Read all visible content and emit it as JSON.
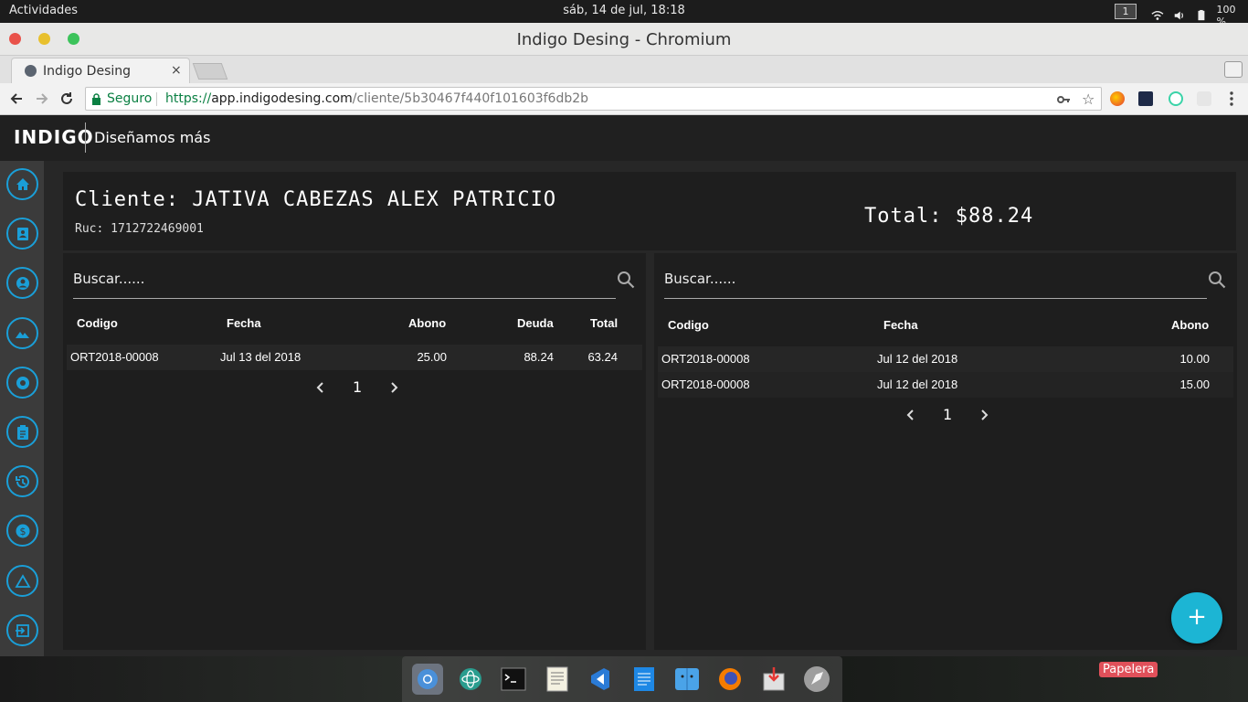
{
  "system_bar": {
    "activities": "Actividades",
    "clock": "sáb, 14 de jul, 18:18",
    "workspace": "1",
    "battery": "100 %"
  },
  "window": {
    "title": "Indigo Desing - Chromium"
  },
  "browser": {
    "tab_title": "Indigo Desing",
    "tab_close": "×",
    "secure_label": "Seguro",
    "url_scheme": "https://",
    "url_host": "app.indigodesing.com",
    "url_path": "/cliente/5b30467f440f101603f6db2b"
  },
  "app": {
    "logo": "INDIGO",
    "tagline": "Diseñamos más"
  },
  "client": {
    "name": "Cliente: JATIVA CABEZAS ALEX PATRICIO",
    "ruc": "Ruc: 1712722469001",
    "total": "Total: $88.24"
  },
  "left_panel": {
    "search_placeholder": "Buscar......",
    "columns": [
      "Codigo",
      "Fecha",
      "Abono",
      "Deuda",
      "Total"
    ],
    "rows": [
      [
        "ORT2018-00008",
        "Jul 13 del 2018",
        "25.00",
        "88.24",
        "63.24"
      ]
    ],
    "page": "1"
  },
  "right_panel": {
    "search_placeholder": "Buscar......",
    "columns": [
      "Codigo",
      "Fecha",
      "Abono"
    ],
    "rows": [
      [
        "ORT2018-00008",
        "Jul 12 del 2018",
        "10.00"
      ],
      [
        "ORT2018-00008",
        "Jul 12 del 2018",
        "15.00"
      ]
    ],
    "page": "1"
  },
  "fab": {
    "label": "+"
  },
  "desktop": {
    "trash_label": "Papelera"
  },
  "colors": {
    "accent": "#1a9fd8",
    "fab": "#1cb5d4",
    "secure": "#0b8043"
  },
  "sidebar_icons": [
    "home-icon",
    "contacts-icon",
    "account-icon",
    "landscape-icon",
    "camera-aperture-icon",
    "clipboard-icon",
    "history-icon",
    "dollar-icon",
    "triangle-icon",
    "logout-icon"
  ]
}
